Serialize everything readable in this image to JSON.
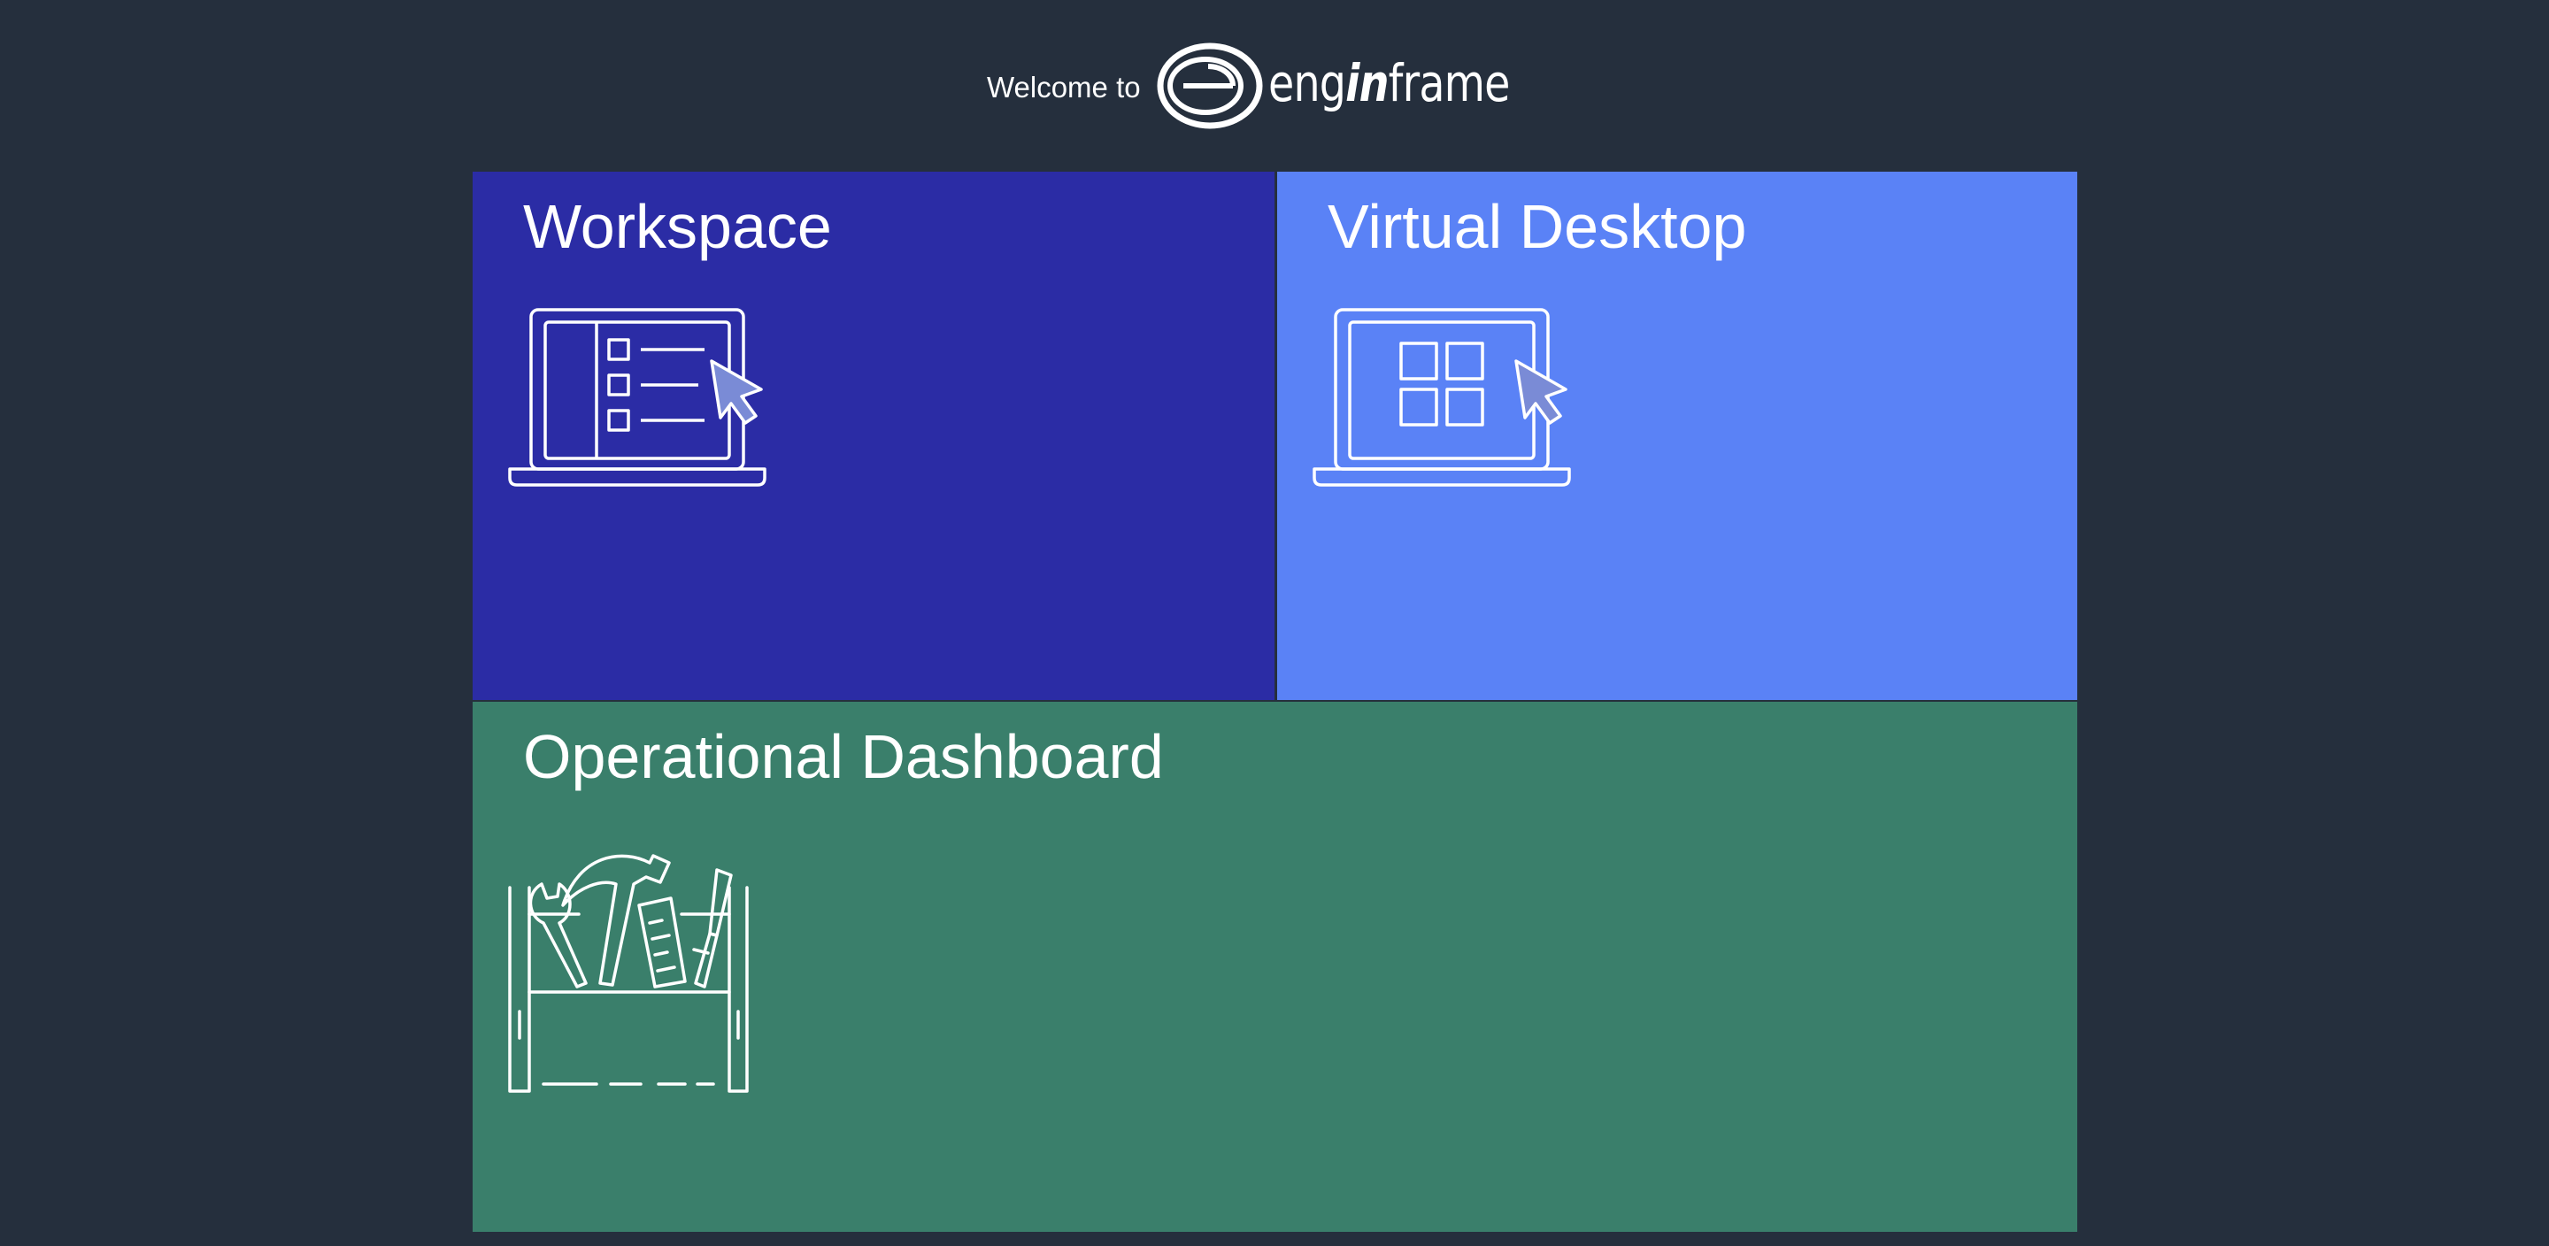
{
  "header": {
    "welcome_text": "Welcome to",
    "logo_text_prefix": "eng",
    "logo_text_in": "in",
    "logo_text_suffix": "frame"
  },
  "tiles": [
    {
      "title": "Workspace",
      "color": "#2b2ca5",
      "icon": "laptop-list-icon"
    },
    {
      "title": "Virtual Desktop",
      "color": "#5a82f6",
      "icon": "laptop-grid-icon"
    },
    {
      "title": "Operational Dashboard",
      "color": "#3a7f6b",
      "icon": "toolbox-icon"
    }
  ],
  "colors": {
    "background": "#252f3d",
    "icon_stroke": "#ffffff",
    "cursor_fill": "#7a8bd6"
  }
}
